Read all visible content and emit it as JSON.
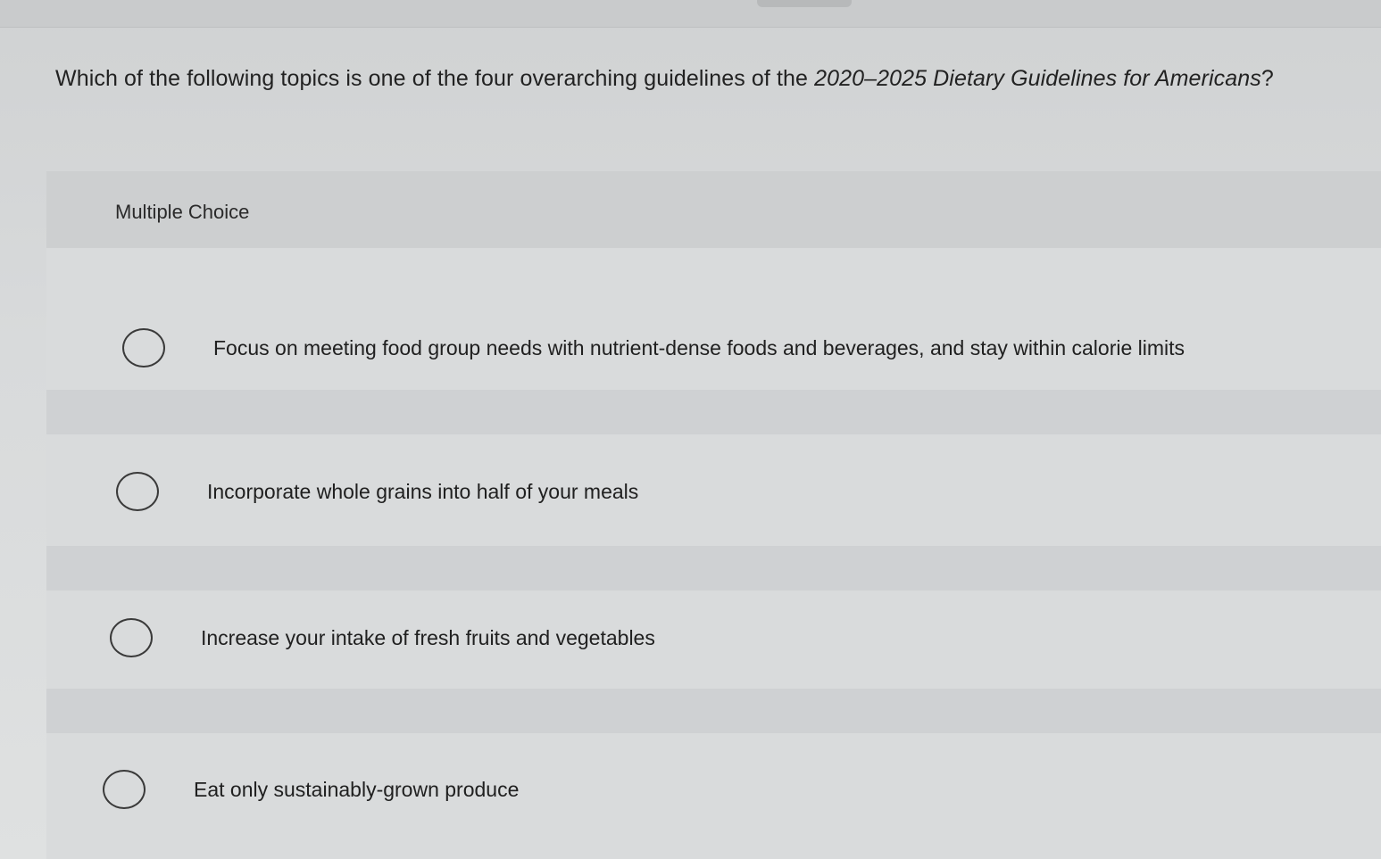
{
  "question": {
    "prefix": "Which of the following topics is one of the four overarching guidelines of the ",
    "title_italic": "2020–2025 Dietary Guidelines for Americans",
    "suffix": "?"
  },
  "question_type": "Multiple Choice",
  "options": [
    {
      "label": "Focus on meeting food group needs with nutrient-dense foods and beverages, and stay within calorie limits",
      "selected": false
    },
    {
      "label": "Incorporate whole grains into half of your meals",
      "selected": false
    },
    {
      "label": "Increase your intake of fresh fruits and vegetables",
      "selected": false
    },
    {
      "label": "Eat only sustainably-grown produce",
      "selected": false
    }
  ]
}
